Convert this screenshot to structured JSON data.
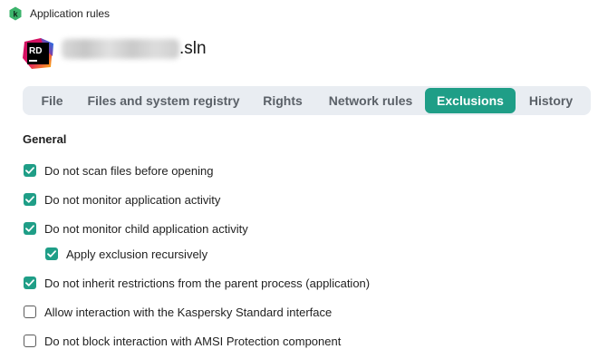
{
  "window": {
    "title": "Application rules",
    "logo_icon": "kaspersky-k-logo"
  },
  "app": {
    "icon": "rider-rd-icon",
    "name_extension": ".sln"
  },
  "tabs": [
    {
      "label": "File",
      "active": false
    },
    {
      "label": "Files and system registry",
      "active": false
    },
    {
      "label": "Rights",
      "active": false
    },
    {
      "label": "Network rules",
      "active": false
    },
    {
      "label": "Exclusions",
      "active": true
    },
    {
      "label": "History",
      "active": false
    }
  ],
  "section": {
    "title": "General"
  },
  "options": [
    {
      "label": "Do not scan files before opening",
      "checked": true
    },
    {
      "label": "Do not monitor application activity",
      "checked": true
    },
    {
      "label": "Do not monitor child application activity",
      "checked": true
    },
    {
      "label": "Apply exclusion recursively",
      "checked": true
    },
    {
      "label": "Do not inherit restrictions from the parent process (application)",
      "checked": true
    },
    {
      "label": "Allow interaction with the Kaspersky Standard interface",
      "checked": false
    },
    {
      "label": "Do not block interaction with AMSI Protection component",
      "checked": false
    }
  ],
  "colors": {
    "accent": "#1f9e87",
    "tab_bar_bg": "#e9edf2",
    "tab_text": "#5b6168"
  }
}
